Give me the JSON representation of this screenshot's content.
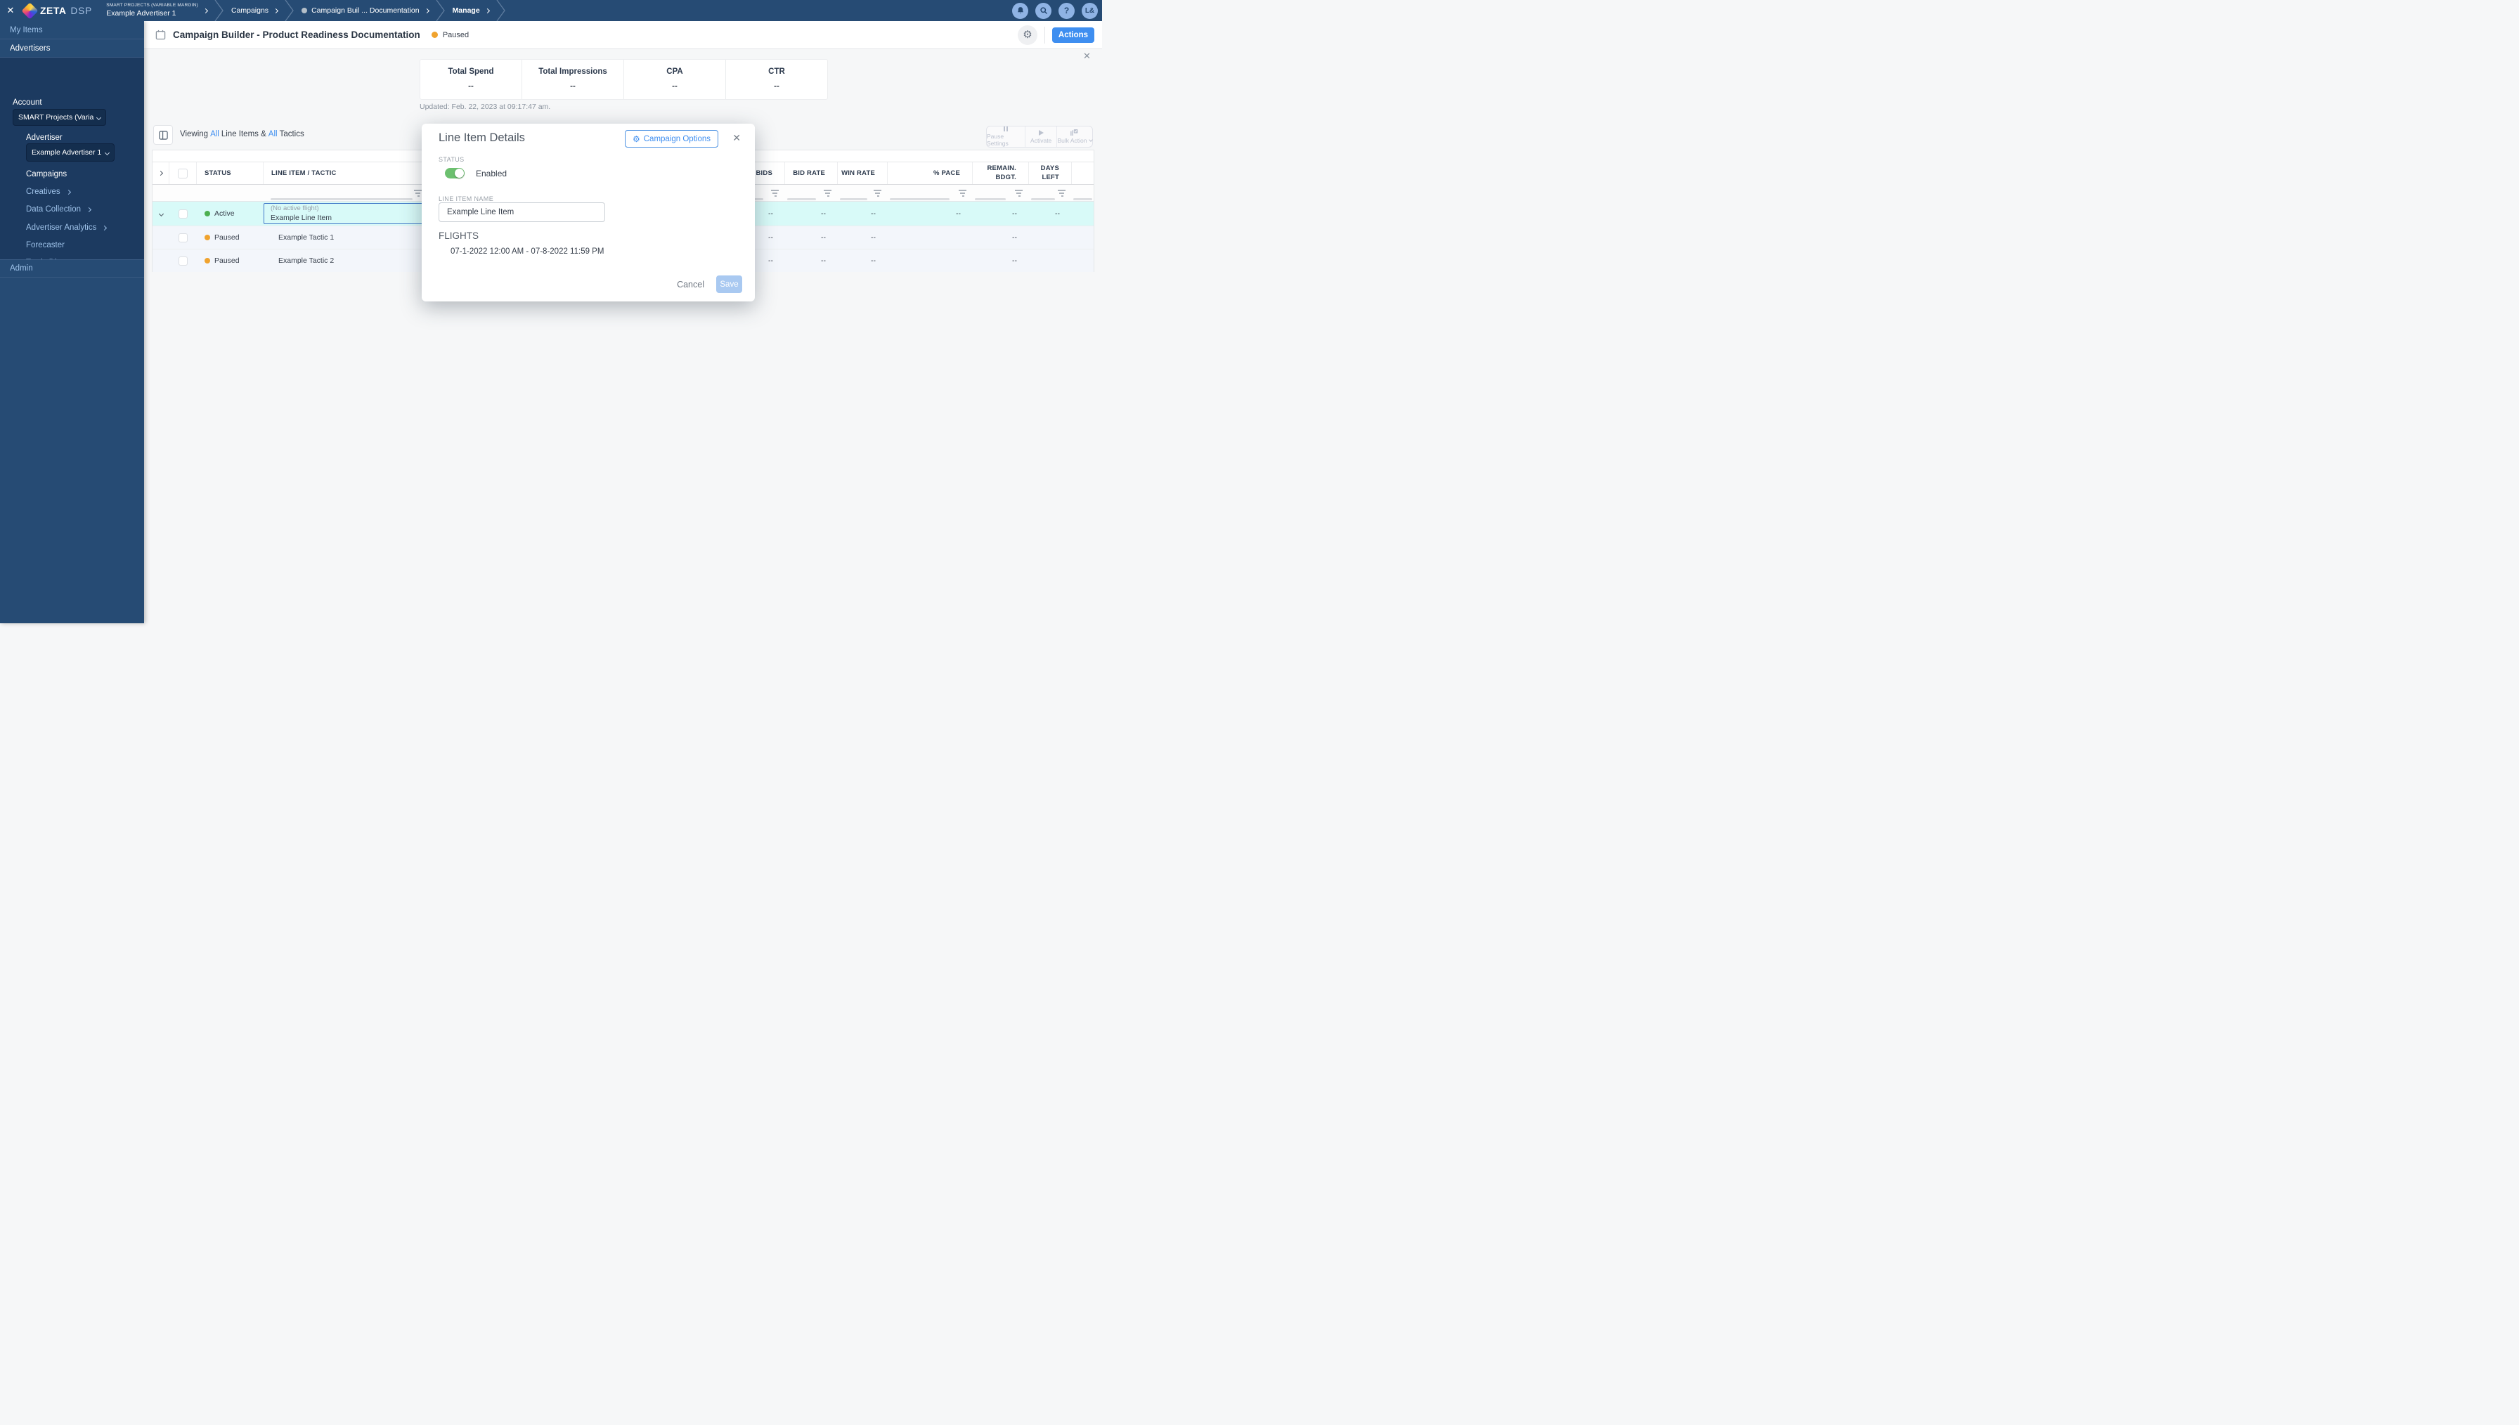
{
  "icons": {
    "close": "✕",
    "gear": "⚙",
    "help": "?"
  },
  "topbar": {
    "brand": "ZETA",
    "product": "DSP",
    "avatar": "L&",
    "breadcrumbs": [
      {
        "eyebrow": "SMART PROJECTS (VARIABLE MARGIN)",
        "label": "Example Advertiser 1"
      },
      {
        "label": "Campaigns"
      },
      {
        "label": "Campaign Buil ... Documentation"
      },
      {
        "label": "Manage"
      }
    ]
  },
  "sidebar": {
    "my_items": "My Items",
    "advertisers": "Advertisers",
    "account_label": "Account",
    "account_value": "SMART Projects (Variable M..",
    "advertiser_label": "Advertiser",
    "advertiser_value": "Example Advertiser 1",
    "campaigns": "Campaigns",
    "links": [
      {
        "label": "Creatives"
      },
      {
        "label": "Data Collection"
      },
      {
        "label": "Advertiser Analytics"
      },
      {
        "label": "Forecaster"
      },
      {
        "label": "Tactic Diagnoser"
      }
    ],
    "admin": "Admin"
  },
  "header": {
    "title": "Campaign Builder - Product Readiness Documentation",
    "status": "Paused",
    "actions_label": "Actions",
    "status_color": "#F0A32E"
  },
  "stats": {
    "items": [
      {
        "label": "Total Spend",
        "value": "--"
      },
      {
        "label": "Total Impressions",
        "value": "--"
      },
      {
        "label": "CPA",
        "value": "--"
      },
      {
        "label": "CTR",
        "value": "--"
      }
    ],
    "updated": "Updated: Feb. 22, 2023 at 09:17:47 am."
  },
  "toolbar": {
    "viewing": [
      "Viewing",
      "All",
      "Line Items &",
      "All",
      "Tactics"
    ],
    "pause_settings": "Pause Settings",
    "activate": "Activate",
    "bulk_action": "Bulk Action"
  },
  "table": {
    "columns": [
      "STATUS",
      "LINE ITEM / TACTIC",
      "BIDS",
      "BID RATE",
      "WIN RATE",
      "% PACE",
      "REMAIN. BDGT.",
      "DAYS LEFT"
    ],
    "rows": [
      {
        "status": "Active",
        "status_color": "#4CAF50",
        "flight_note": "(No active flight)",
        "name": "Example Line Item",
        "values": [
          "--",
          "--",
          "--",
          "--",
          "--",
          "--"
        ]
      },
      {
        "status": "Paused",
        "status_color": "#F0A32E",
        "name": "Example Tactic 1",
        "values": [
          "--",
          "--",
          "--",
          "",
          "--",
          ""
        ]
      },
      {
        "status": "Paused",
        "status_color": "#F0A32E",
        "name": "Example Tactic 2",
        "values": [
          "--",
          "--",
          "--",
          "",
          "--",
          ""
        ]
      }
    ]
  },
  "modal": {
    "title": "Line Item Details",
    "campaign_options": "Campaign Options",
    "status_label": "STATUS",
    "status_value": "Enabled",
    "name_label": "LINE ITEM NAME",
    "name_value": "Example Line Item",
    "flights_label": "FLIGHTS",
    "flights_value": "07-1-2022 12:00 AM - 07-8-2022 11:59 PM",
    "cancel_label": "Cancel",
    "save_label": "Save"
  }
}
